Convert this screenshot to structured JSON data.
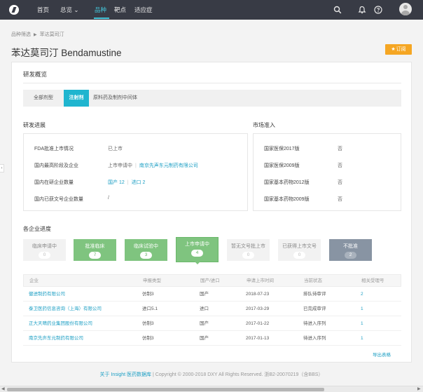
{
  "nav": {
    "items": [
      "首页",
      "总览 ⌄",
      "品种",
      "靶点",
      "适应症"
    ],
    "active_index": 2,
    "icons": [
      "search-icon",
      "bell-icon",
      "help-icon",
      "avatar"
    ]
  },
  "breadcrumb": {
    "items": [
      "品种筛选",
      "苯达莫司汀"
    ]
  },
  "page": {
    "title": "苯达莫司汀 Bendamustine",
    "subscribe_label": "订阅"
  },
  "overview": {
    "title": "研发概览",
    "tabs": [
      "全部剂型",
      "注射剂",
      "原料药及制剂中间体"
    ],
    "active_tab": 1
  },
  "rd_progress": {
    "title": "研发进展",
    "rows": [
      {
        "label": "FDA批准上市情况",
        "value": "已上市"
      },
      {
        "label": "国内最高阶段及企业",
        "stage": "上市申请中",
        "company": "南京先声东元制药有限公司"
      },
      {
        "label": "国内在研企业数量",
        "domestic": "国产 12",
        "imported": "进口 2"
      },
      {
        "label": "国内已获文号企业数量",
        "value": "/"
      }
    ]
  },
  "market_access": {
    "title": "市场准入",
    "rows": [
      {
        "label": "国家医保2017版",
        "value": "否"
      },
      {
        "label": "国家医保2009版",
        "value": "否"
      },
      {
        "label": "国家基本药物2012版",
        "value": "否"
      },
      {
        "label": "国家基本药物2009版",
        "value": "否"
      }
    ]
  },
  "company_progress": {
    "title": "各企业进度",
    "stages": [
      {
        "label": "临床申请中",
        "count": "0",
        "style": "gray"
      },
      {
        "label": "批准临床",
        "count": "7",
        "style": "green"
      },
      {
        "label": "临床试验中",
        "count": "3",
        "style": "green"
      },
      {
        "label": "上市申请中",
        "count": "4",
        "style": "green",
        "current": true
      },
      {
        "label": "暂无文号批上市",
        "count": "0",
        "style": "gray"
      },
      {
        "label": "已获得上市文号",
        "count": "0",
        "style": "gray"
      },
      {
        "label": "不批准",
        "count": "2",
        "style": "slate"
      }
    ]
  },
  "table": {
    "headers": [
      "企业",
      "申报类型",
      "国产/进口",
      "申请上市时间",
      "当前状态",
      "相关受理号"
    ],
    "rows": [
      [
        "健进制药有限公司",
        "仿制3",
        "国产",
        "2018-07-23",
        "排队待审评",
        "2"
      ],
      [
        "泰卫医药信息咨询（上海）有限公司",
        "进口5.1",
        "进口",
        "2017-03-29",
        "已完成审评",
        "1"
      ],
      [
        "正大天晴药业集团股份有限公司",
        "仿制3",
        "国产",
        "2017-01-22",
        "待进入序列",
        "1"
      ],
      [
        "南京先声东元制药有限公司",
        "仿制3",
        "国产",
        "2017-01-13",
        "待进入序列",
        "1"
      ]
    ],
    "export_label": "导出表格"
  },
  "footer": {
    "link_text": "关于 Insight 医药数据库",
    "copyright": " | Copyright © 2000-2018 DXY All Rights Reserved. 浙B2-20070219（含BBS）"
  },
  "colors": {
    "nav_bg": "#383b45",
    "accent": "#1fb5cf",
    "link": "#1d9fc4",
    "stage_green": "#7fc47f",
    "stage_slate": "#8894a3",
    "subscribe": "#f5a623"
  }
}
